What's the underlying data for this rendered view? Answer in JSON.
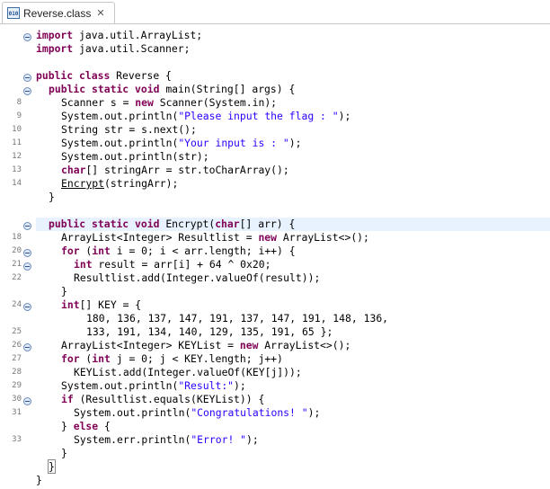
{
  "tab": {
    "label": "Reverse.class",
    "icon": "010"
  },
  "line_numbers": [
    "8",
    "9",
    "10",
    "11",
    "12",
    "13",
    "14",
    "18",
    "20",
    "21",
    "22",
    "24",
    "25",
    "26",
    "27",
    "28",
    "29",
    "30",
    "31",
    "33"
  ],
  "code": {
    "l1": {
      "kw": "import",
      "rest": " java.util.ArrayList;"
    },
    "l2": {
      "kw": "import",
      "rest": " java.util.Scanner;"
    },
    "l4": {
      "kw1": "public",
      "kw2": "class",
      "rest": " Reverse {"
    },
    "l5": {
      "kw1": "public",
      "kw2": "static",
      "kw3": "void",
      "rest": " main(String[] args) {"
    },
    "l6": {
      "a": "Scanner s = ",
      "kw": "new",
      "b": " Scanner(System.in);"
    },
    "l7": {
      "a": "System.out.println(",
      "s": "\"Please input the flag : \"",
      "b": ");"
    },
    "l8": "String str = s.next();",
    "l9": {
      "a": "System.out.println(",
      "s": "\"Your input is : \"",
      "b": ");"
    },
    "l10": "System.out.println(str);",
    "l11": {
      "kw": "char",
      "rest": "[] stringArr = str.toCharArray();"
    },
    "l12": {
      "u": "Encrypt",
      "rest": "(stringArr);"
    },
    "l13": "}",
    "l15": {
      "kw1": "public",
      "kw2": "static",
      "kw3": "void",
      "a": " Encrypt(",
      "kw4": "char",
      "b": "[] arr) {"
    },
    "l16": {
      "a": "ArrayList<Integer> Resultlist = ",
      "kw": "new",
      "b": " ArrayList<>();"
    },
    "l17": {
      "kw1": "for",
      "a": " (",
      "kw2": "int",
      "b": " i = 0; i < arr.length; i++) {"
    },
    "l18": {
      "kw": "int",
      "rest": " result = arr[i] + 64 ^ 0x20;"
    },
    "l19": "Resultlist.add(Integer.valueOf(result));",
    "l20": "}",
    "l21": {
      "kw": "int",
      "rest": "[] KEY = {"
    },
    "l22": "180, 136, 137, 147, 191, 137, 147, 191, 148, 136,",
    "l23": "133, 191, 134, 140, 129, 135, 191, 65 };",
    "l24": {
      "a": "ArrayList<Integer> KEYList = ",
      "kw": "new",
      "b": " ArrayList<>();"
    },
    "l25": {
      "kw1": "for",
      "a": " (",
      "kw2": "int",
      "b": " j = 0; j < KEY.length; j++)"
    },
    "l26": "KEYList.add(Integer.valueOf(KEY[j]));",
    "l27": {
      "a": "System.out.println(",
      "s": "\"Result:\"",
      "b": ");"
    },
    "l28": {
      "kw": "if",
      "rest": " (Resultlist.equals(KEYList)) {"
    },
    "l29": {
      "a": "System.out.println(",
      "s": "\"Congratulations! \"",
      "b": ");"
    },
    "l30": {
      "a": "} ",
      "kw": "else",
      "b": " {"
    },
    "l31": {
      "a": "System.err.println(",
      "s": "\"Error! \"",
      "b": ");"
    },
    "l32": "}",
    "l33": "}",
    "l34": "}"
  },
  "colors": {
    "keyword": "#7f0055",
    "string": "#2a00ff",
    "line_highlight": "#e8f2fe"
  }
}
